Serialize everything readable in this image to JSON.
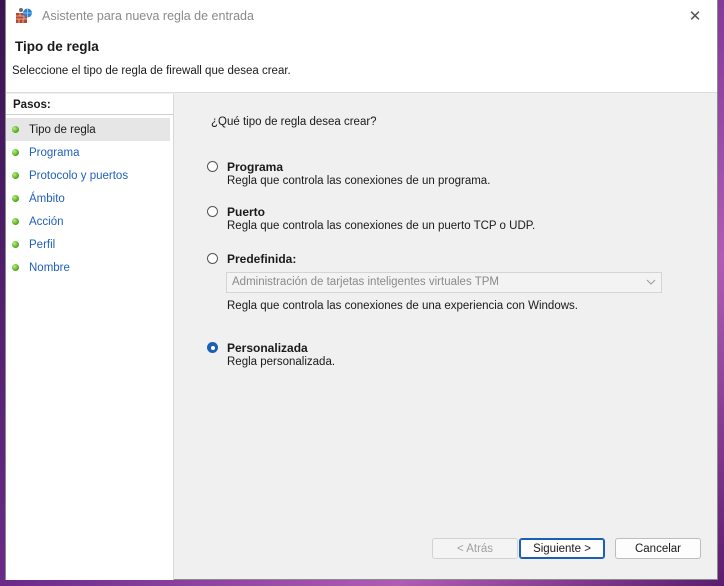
{
  "window": {
    "title": "Asistente para nueva regla de entrada",
    "close_glyph": "✕"
  },
  "header": {
    "title": "Tipo de regla",
    "subtitle": "Seleccione el tipo de regla de firewall que desea crear."
  },
  "sidebar": {
    "title": "Pasos:",
    "items": [
      {
        "label": "Tipo de regla",
        "active": true
      },
      {
        "label": "Programa"
      },
      {
        "label": "Protocolo y puertos"
      },
      {
        "label": "Ámbito"
      },
      {
        "label": "Acción"
      },
      {
        "label": "Perfil"
      },
      {
        "label": "Nombre"
      }
    ]
  },
  "main": {
    "question": "¿Qué tipo de regla desea crear?",
    "options": [
      {
        "label": "Programa",
        "description": "Regla que controla las conexiones de un programa.",
        "checked": false
      },
      {
        "label": "Puerto",
        "description": "Regla que controla las conexiones de un puerto TCP o UDP.",
        "checked": false
      },
      {
        "label": "Predefinida:",
        "checked": false
      },
      {
        "label": "Personalizada",
        "description": "Regla personalizada.",
        "checked": true
      }
    ],
    "predefined_select": {
      "value": "Administración de tarjetas inteligentes virtuales TPM",
      "description": "Regla que controla las conexiones de una experiencia con Windows."
    }
  },
  "buttons": {
    "back": "< Atrás",
    "next": "Siguiente >",
    "cancel": "Cancelar"
  },
  "colors": {
    "accent": "#1a5fb4",
    "link": "#1f5fbf",
    "step_dot": "#4aa21a"
  }
}
